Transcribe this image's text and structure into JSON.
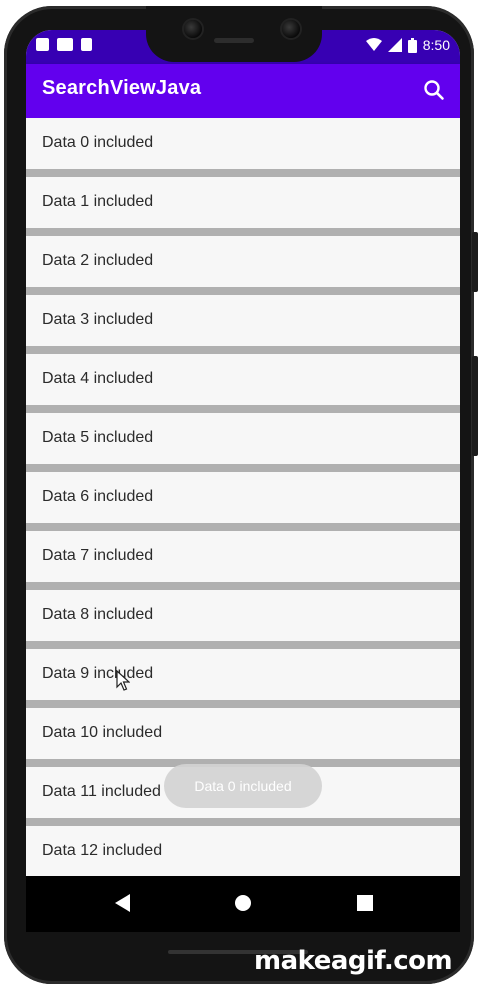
{
  "status_bar": {
    "time": "8:50",
    "icons_left": [
      "sim-icon",
      "image-icon",
      "font-icon"
    ],
    "icons_right": [
      "wifi-icon",
      "signal-icon",
      "battery-icon"
    ]
  },
  "app_bar": {
    "title": "SearchViewJava",
    "action_icon": "search-icon"
  },
  "list": {
    "items": [
      {
        "label": "Data 0 included"
      },
      {
        "label": "Data 1 included"
      },
      {
        "label": "Data 2 included"
      },
      {
        "label": "Data 3 included"
      },
      {
        "label": "Data 4 included"
      },
      {
        "label": "Data 5 included"
      },
      {
        "label": "Data 6 included"
      },
      {
        "label": "Data 7 included"
      },
      {
        "label": "Data 8 included"
      },
      {
        "label": "Data 9 included"
      },
      {
        "label": "Data 10 included"
      },
      {
        "label": "Data 11 included"
      },
      {
        "label": "Data 12 included"
      }
    ]
  },
  "toast": {
    "text": "Data 0 included"
  },
  "nav_bar": {
    "buttons": [
      "back-icon",
      "home-icon",
      "recents-icon"
    ]
  },
  "watermark": "makeagif.com",
  "colors": {
    "primary": "#6200ee",
    "primary_dark": "#3700b3",
    "divider": "#b0b0b0",
    "row_bg": "#f7f7f7"
  }
}
